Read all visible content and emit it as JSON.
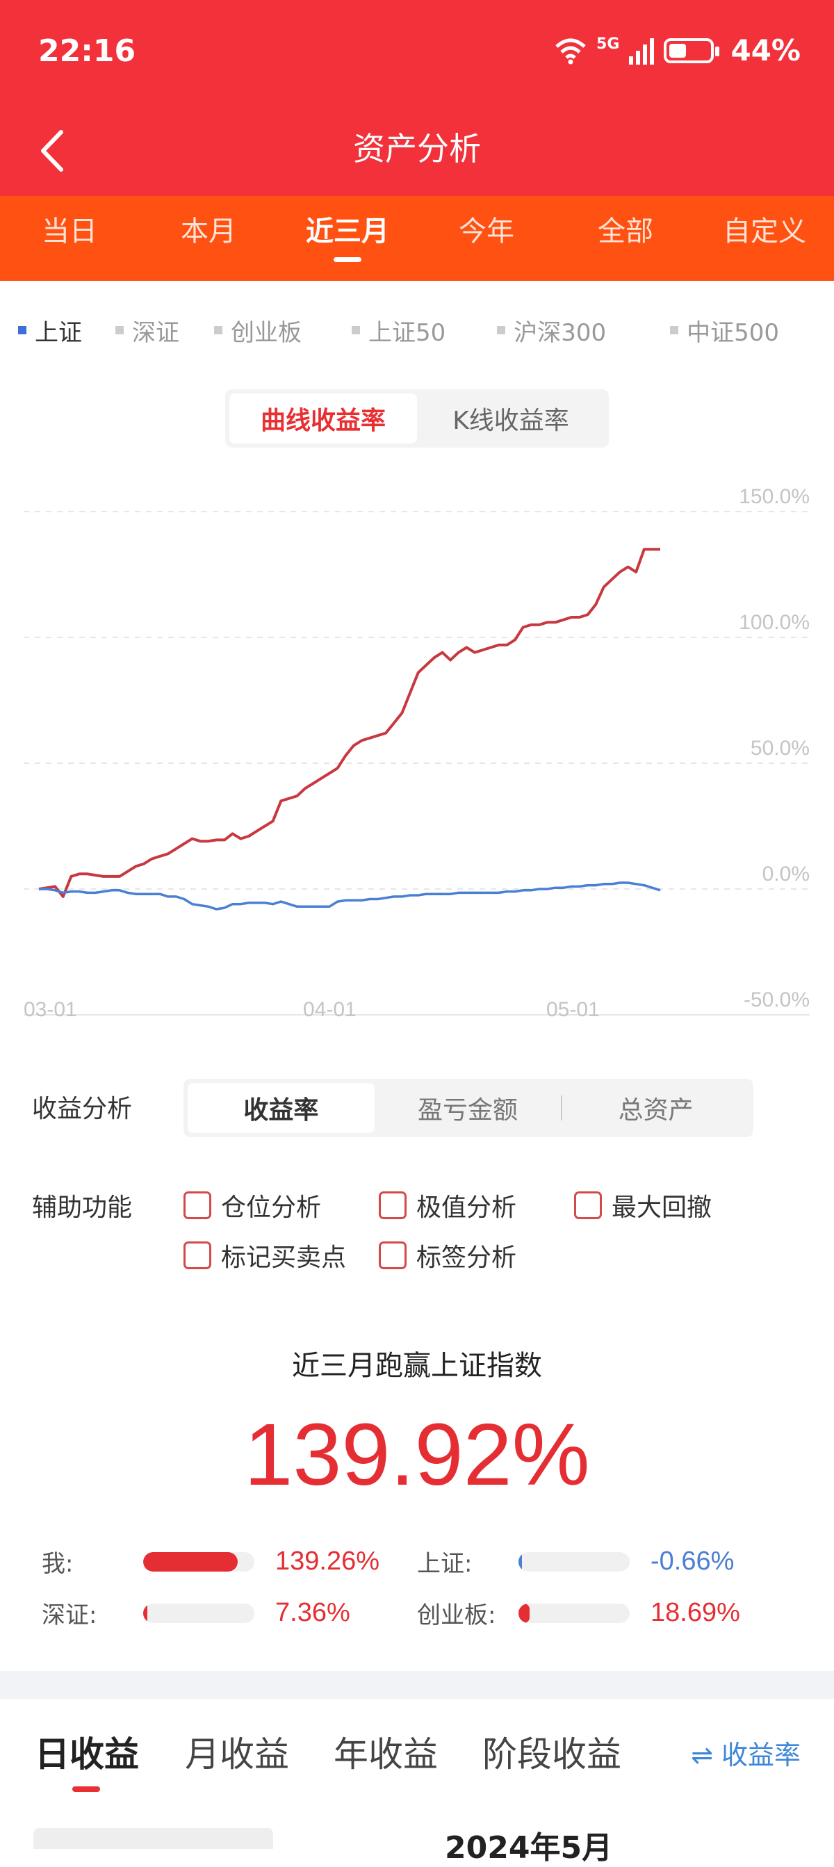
{
  "status_bar": {
    "time": "22:16",
    "network": "5G",
    "battery": "44%"
  },
  "header": {
    "title": "资产分析"
  },
  "period_tabs": [
    {
      "label": "当日",
      "active": false
    },
    {
      "label": "本月",
      "active": false
    },
    {
      "label": "近三月",
      "active": true
    },
    {
      "label": "今年",
      "active": false
    },
    {
      "label": "全部",
      "active": false
    },
    {
      "label": "自定义",
      "active": false
    }
  ],
  "index_selector": [
    {
      "label": "上证",
      "active": true
    },
    {
      "label": "深证",
      "active": false
    },
    {
      "label": "创业板",
      "active": false
    },
    {
      "label": "上证50",
      "active": false
    },
    {
      "label": "沪深300",
      "active": false
    },
    {
      "label": "中证500",
      "active": false
    }
  ],
  "chart_toggle": {
    "curve": "曲线收益率",
    "kline": "K线收益率",
    "selected": "curve"
  },
  "chart_data": {
    "type": "line",
    "y_ticks": [
      "150.0%",
      "100.0%",
      "50.0%",
      "0.0%",
      "-50.0%"
    ],
    "ylim": [
      -50,
      150
    ],
    "x_ticks": [
      "03-01",
      "04-01",
      "05-01"
    ],
    "series": [
      {
        "color": "#c8383f",
        "values": [
          0,
          0.5,
          1,
          -3,
          5,
          6,
          6,
          5.5,
          5,
          5,
          5,
          7,
          9,
          10,
          12,
          13,
          14,
          16,
          18,
          20,
          19,
          19,
          19.5,
          19.5,
          22,
          20,
          21,
          23,
          25,
          27,
          35,
          36,
          37,
          40,
          42,
          44,
          46,
          48,
          53,
          57,
          59,
          60,
          61,
          62,
          66,
          70,
          78,
          86,
          89,
          92,
          94,
          91,
          94,
          96,
          94,
          95,
          96,
          97,
          97,
          99,
          104,
          105,
          105,
          106,
          106,
          107,
          108,
          108,
          109,
          113,
          120,
          123,
          126,
          128,
          126,
          135,
          135,
          135
        ],
        "name": ""
      },
      {
        "color": "#4a7fd4",
        "values": [
          0,
          0,
          -0.5,
          -1.5,
          -1,
          -1,
          -1.5,
          -1.5,
          -1,
          -0.5,
          -0.5,
          -1.5,
          -2,
          -2,
          -2,
          -2,
          -3,
          -3,
          -4,
          -6,
          -6.5,
          -7,
          -8,
          -7.5,
          -6,
          -6,
          -5.5,
          -5.5,
          -5.5,
          -6,
          -5,
          -6,
          -7,
          -7,
          -7,
          -7,
          -7,
          -5,
          -4.5,
          -4.5,
          -4.5,
          -4,
          -4,
          -3.5,
          -3,
          -3,
          -2.5,
          -2.5,
          -2,
          -2,
          -2,
          -2,
          -1.5,
          -1.5,
          -1.5,
          -1.5,
          -1.5,
          -1.5,
          -1,
          -1,
          -0.5,
          -0.5,
          0,
          0,
          0.5,
          0.5,
          1,
          1,
          1.5,
          1.5,
          2,
          2,
          2.5,
          2.5,
          2,
          1.5,
          0.5,
          -0.5
        ],
        "name": ""
      }
    ]
  },
  "analysis": {
    "label": "收益分析",
    "options": [
      "收益率",
      "盈亏金额",
      "总资产"
    ],
    "selected": 0
  },
  "aux": {
    "label": "辅助功能",
    "options": [
      "仓位分析",
      "极值分析",
      "最大回撤",
      "标记买卖点",
      "标签分析"
    ]
  },
  "summary": {
    "headline": "近三月跑赢上证指数",
    "big_value": "139.92%"
  },
  "comparisons": [
    {
      "name": "我:",
      "value": "139.26%",
      "fill": 0.85,
      "color": "#e52e33"
    },
    {
      "name": "上证:",
      "value": "-0.66%",
      "fill": 0.005,
      "color": "#4a7fd4"
    },
    {
      "name": "深证:",
      "value": "7.36%",
      "fill": 0.04,
      "color": "#e52e33"
    },
    {
      "name": "创业板:",
      "value": "18.69%",
      "fill": 0.1,
      "color": "#e52e33"
    }
  ],
  "bottom_tabs": {
    "items": [
      "日收益",
      "月收益",
      "年收益",
      "阶段收益"
    ],
    "active": 0,
    "switch_label": "⇌ 收益率",
    "partial_text": "2024年5月"
  }
}
